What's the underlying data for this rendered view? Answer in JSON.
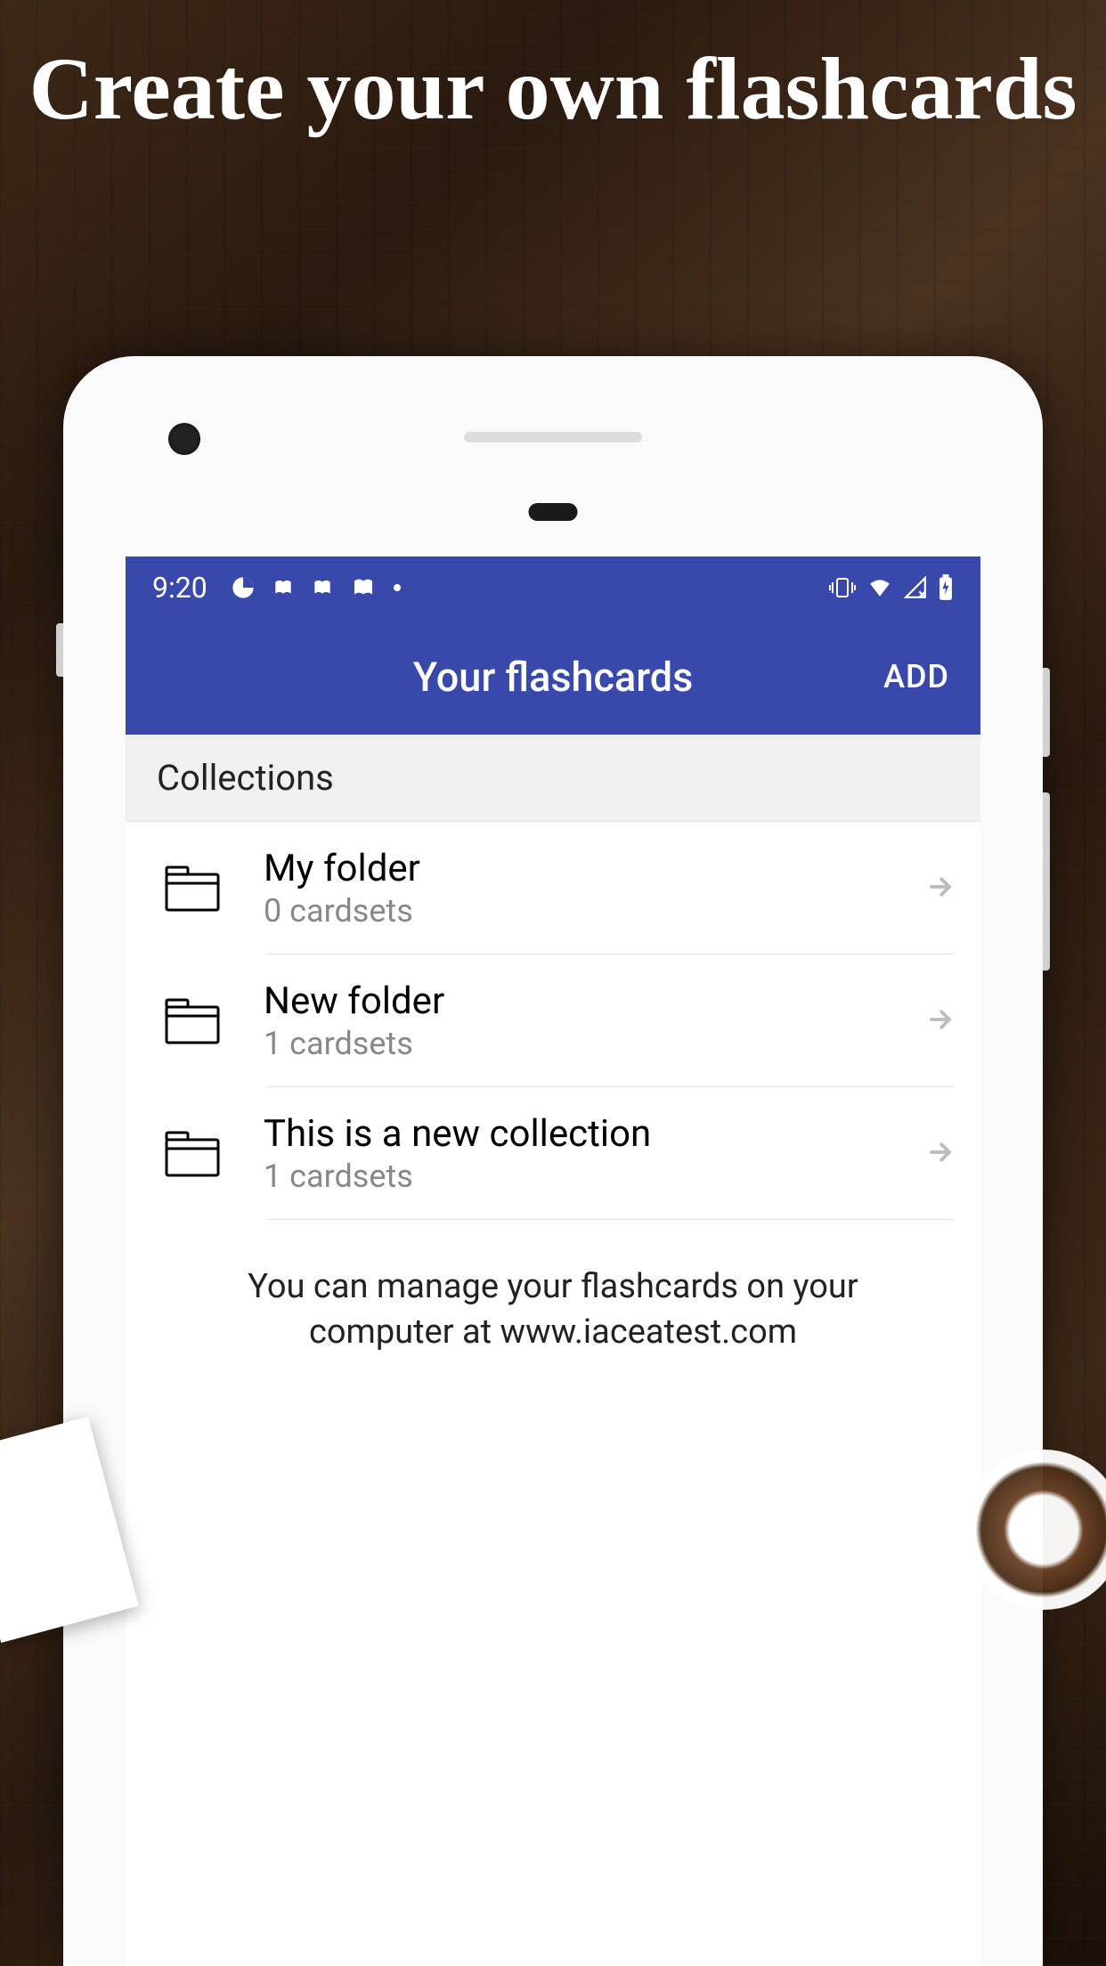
{
  "promo": {
    "headline": "Create your own flashcards"
  },
  "status_bar": {
    "time": "9:20"
  },
  "app_bar": {
    "title": "Your flashcards",
    "action": "ADD"
  },
  "section": {
    "header": "Collections"
  },
  "collections": [
    {
      "title": "My folder",
      "subtitle": "0 cardsets"
    },
    {
      "title": "New folder",
      "subtitle": "1 cardsets"
    },
    {
      "title": "This is a new collection",
      "subtitle": "1 cardsets"
    }
  ],
  "footer": {
    "text": "You can manage your flashcards on your computer at www.iaceatest.com"
  }
}
